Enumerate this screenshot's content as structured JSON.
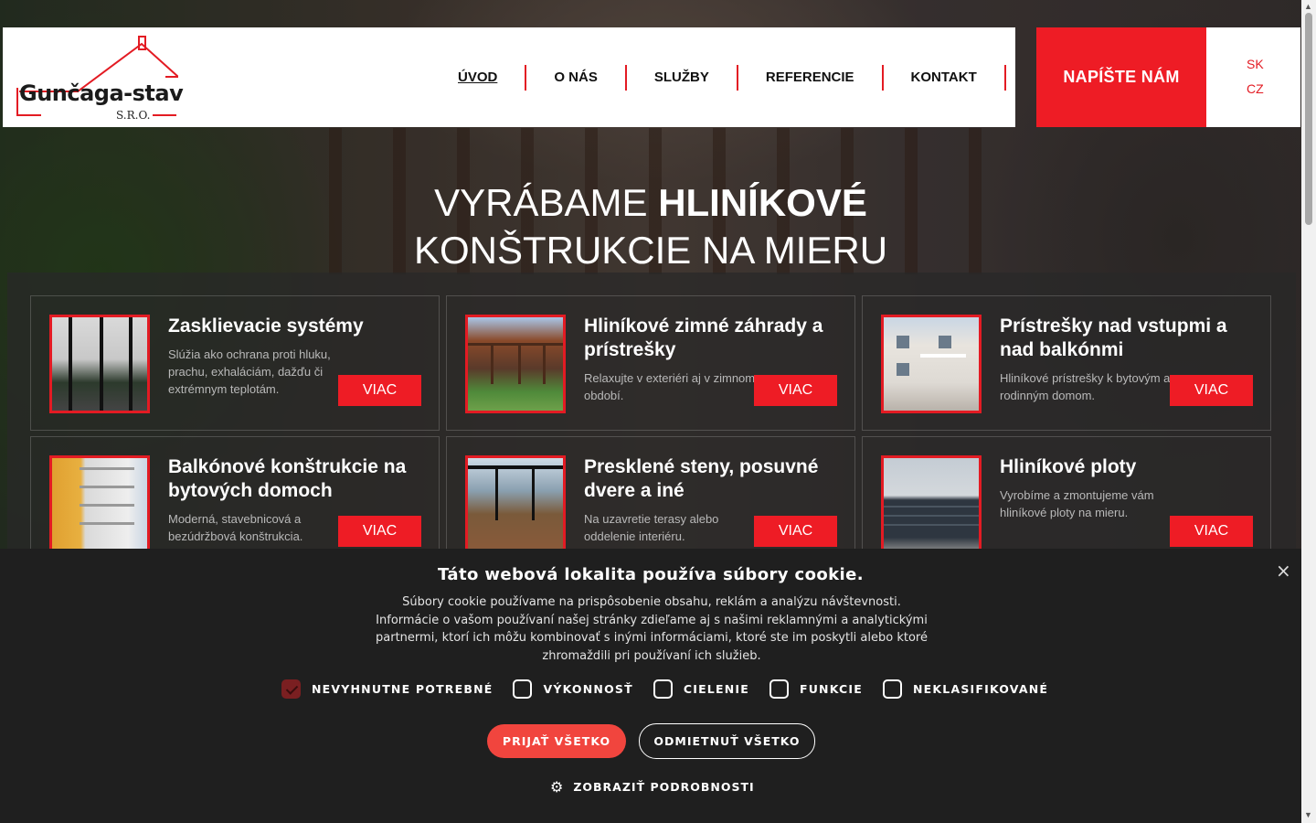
{
  "header": {
    "logo_text": "Gunčaga-stav",
    "logo_sub": "S.R.O.",
    "nav": [
      "ÚVOD",
      "O NÁS",
      "SLUŽBY",
      "REFERENCIE",
      "KONTAKT"
    ],
    "cta": "NAPÍŠTE NÁM",
    "languages": [
      "SK",
      "CZ"
    ]
  },
  "hero": {
    "title_light": "VYRÁBAME ",
    "title_bold": "HLINÍKOVÉ",
    "title_line2": "KONŠTRUKCIE NA MIERU"
  },
  "services": [
    {
      "title": "Zasklievacie systémy",
      "desc": "Slúžia ako ochrana proti hluku, prachu, exhaláciám, dažďu či extrémnym teplotám.",
      "button": "VIAC"
    },
    {
      "title": "Hliníkové zimné záhrady a prístrešky",
      "desc": "Relaxujte v exteriéri aj v zimnom období.",
      "button": "VIAC"
    },
    {
      "title": "Prístrešky nad vstupmi a nad balkónmi",
      "desc": "Hliníkové prístrešky k bytovým a rodinným domom.",
      "button": "VIAC"
    },
    {
      "title": "Balkónové konštrukcie na bytových domoch",
      "desc": "Moderná, stavebnicová a bezúdržbová konštrukcia.",
      "button": "VIAC"
    },
    {
      "title": "Presklené steny, posuvné dvere a iné",
      "desc": "Na uzavretie terasy alebo oddelenie interiéru.",
      "button": "VIAC"
    },
    {
      "title": "Hliníkové ploty",
      "desc": "Vyrobíme a zmontujeme vám hliníkové ploty na mieru.",
      "button": "VIAC"
    }
  ],
  "cookie": {
    "title": "Táto webová lokalita používa súbory cookie.",
    "text": "Súbory cookie používame na prispôsobenie obsahu, reklám a analýzu návštevnosti. Informácie o vašom používaní našej stránky zdieľame aj s našimi reklamnými a analytickými partnermi, ktorí ich môžu kombinovať s inými informáciami, ktoré ste im poskytli alebo ktoré zhromaždili pri používaní ich služieb.",
    "options": [
      {
        "label": "NEVYHNUTNE POTREBNÉ",
        "checked": true
      },
      {
        "label": "VÝKONNOSŤ",
        "checked": false
      },
      {
        "label": "CIELENIE",
        "checked": false
      },
      {
        "label": "FUNKCIE",
        "checked": false
      },
      {
        "label": "NEKLASIFIKOVANÉ",
        "checked": false
      }
    ],
    "accept": "PRIJAŤ VŠETKO",
    "reject": "ODMIETNUŤ VŠETKO",
    "details": "ZOBRAZIŤ PODROBNOSTI",
    "close": "×"
  },
  "colors": {
    "accent": "#ee1c25",
    "cookie_bg": "#1f1f1f",
    "accept_bg": "#f1453e"
  }
}
